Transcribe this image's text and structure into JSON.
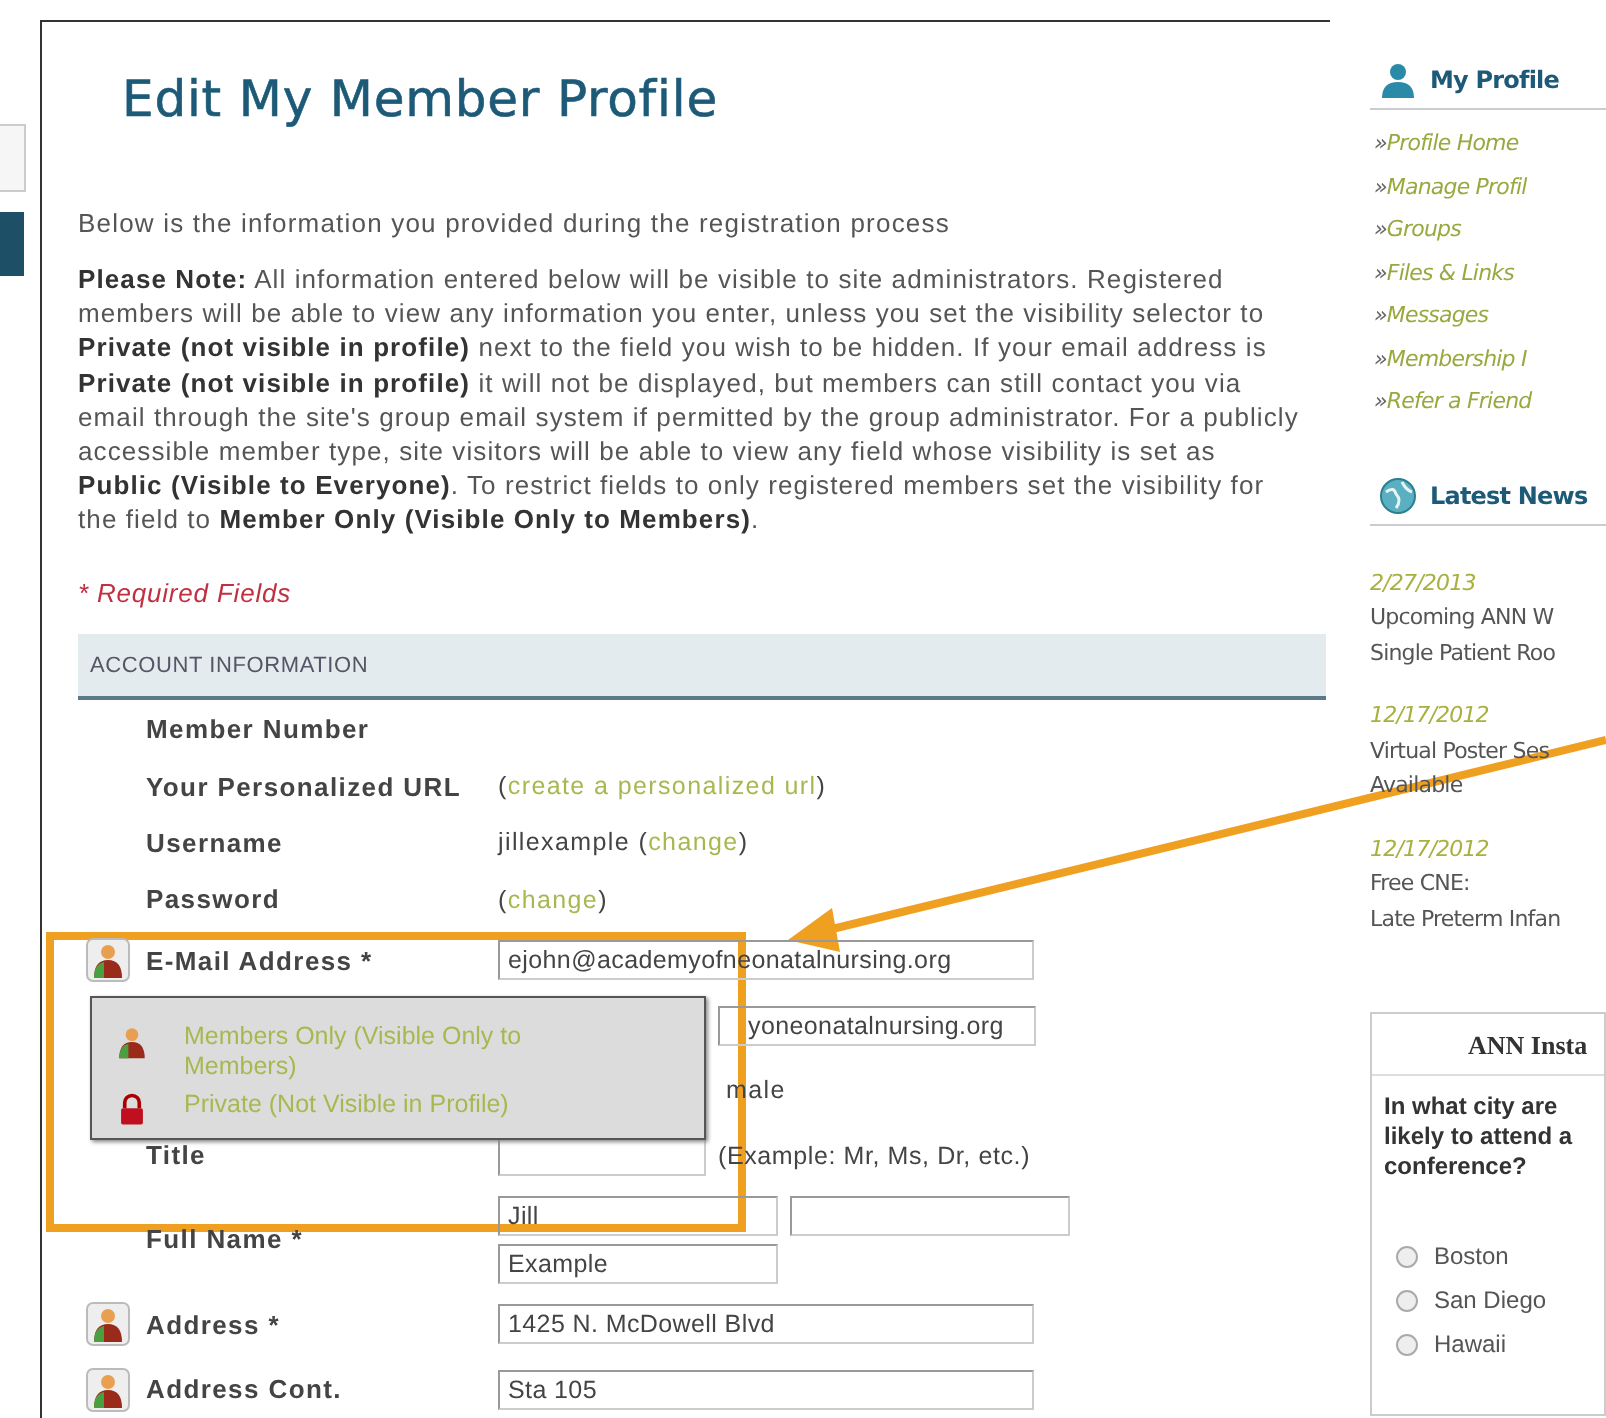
{
  "page": {
    "title": "Edit My Member Profile",
    "intro": "Below is the information you provided during the registration process",
    "note": "**Please Note:** All information entered below will be visible to site administrators. Registered members will be able to view any information you enter, unless you set the visibility selector to **Private (not visible in profile)** next to the field you wish to be hidden. If your email address is **Private (not visible in profile)** it will not be displayed, but members can still contact you via email through the site's group email system if permitted by the group administrator. For a publicly accessible member type, site visitors will be able to view any field whose visibility is set as **Public (Visible to Everyone)**. To restrict fields to only registered members set the visibility for the field to **Member Only (Visible Only to Members)**.",
    "required_note": "* Required Fields"
  },
  "section": {
    "title": "ACCOUNT INFORMATION"
  },
  "rows": [
    {
      "kind": "static",
      "label": "Member Number"
    },
    {
      "kind": "link",
      "label": "Your Personalized URL",
      "before": "(",
      "link": "create a personalized url",
      "after": ")"
    },
    {
      "kind": "link",
      "label": "Username",
      "before": "jillexample (",
      "link": "change",
      "after": ")"
    },
    {
      "kind": "link",
      "label": "Password",
      "before": "(",
      "link": "change",
      "after": ")"
    },
    {
      "kind": "field",
      "label": "E-Mail Address *",
      "private": false,
      "value": "ejohn@academyofneonatalnursing.org"
    },
    {
      "kind": "covered-field",
      "value": "yoneonatalnursing.org"
    },
    {
      "kind": "covered-text",
      "value": "male"
    },
    {
      "kind": "field",
      "label": "Title",
      "value": "",
      "hint": "(Example: Mr, Ms, Dr, etc.)"
    },
    {
      "kind": "name",
      "label": "Full Name *",
      "first": "Jill",
      "middle": "",
      "last": "Example"
    },
    {
      "kind": "field",
      "label": "Address *",
      "private": false,
      "value": "1425 N. McDowell Blvd"
    },
    {
      "kind": "field",
      "label": "Address Cont.",
      "private": false,
      "value": "Sta 105"
    }
  ],
  "visibility_menu": {
    "options": [
      {
        "kind": "members",
        "label": "Members Only (Visible Only to Members)"
      },
      {
        "kind": "private",
        "label": "Private (Not Visible in Profile)"
      }
    ]
  },
  "sidebar": {
    "profile": {
      "title": "My Profile",
      "items": [
        {
          "marker": "»",
          "label": "Profile Home"
        },
        {
          "marker": "»",
          "label": "Manage Profil"
        },
        {
          "marker": "»",
          "label": "Groups"
        },
        {
          "marker": "»",
          "label": "Files & Links"
        },
        {
          "marker": "»",
          "label": "Messages"
        },
        {
          "marker": "»",
          "label": "Membership I"
        },
        {
          "marker": "»",
          "label": "Refer a Friend"
        }
      ]
    },
    "news": {
      "title": "Latest News",
      "items": [
        {
          "date": "2/27/2013",
          "lines": [
            "Upcoming ANN W",
            "Single Patient Roo"
          ]
        },
        {
          "date": "12/17/2012",
          "lines": [
            "Virtual Poster Ses",
            "Available"
          ]
        },
        {
          "date": "12/17/2012",
          "lines": [
            "Free CNE:",
            "Late Preterm Infan"
          ]
        }
      ]
    },
    "poll": {
      "title": "ANN Insta",
      "question": [
        "In what city are",
        "likely to attend a",
        "conference?"
      ],
      "options": [
        {
          "label": "Boston",
          "selected": false
        },
        {
          "label": "San Diego",
          "selected": false
        },
        {
          "label": "Hawaii",
          "selected": false
        }
      ]
    }
  }
}
